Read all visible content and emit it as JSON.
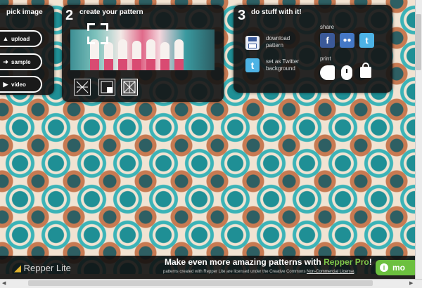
{
  "step1": {
    "title": "pick image",
    "buttons": [
      "upload",
      "sample",
      "video"
    ]
  },
  "step2": {
    "number": "2",
    "title": "create your pattern"
  },
  "step3": {
    "number": "3",
    "title": "do stuff with it!",
    "download": [
      "download",
      "pattern"
    ],
    "twitter": [
      "set as Twitter",
      "background"
    ],
    "share_label": "share",
    "print_label": "print"
  },
  "footer": {
    "promo_prefix": "Make even more amazing patterns with ",
    "promo_link": "Repper Pro",
    "promo_suffix": "!",
    "license_prefix": "patterns created with Repper Lite are licensed under the Creative Commons ",
    "license_link": "Non-Commercial License",
    "license_suffix": ".",
    "app_name": "Repper Lite",
    "more_button": "mo"
  },
  "colors": {
    "accent": "#6cc03f",
    "pattern_teal": "#3bb3b7",
    "panel": "#161616"
  },
  "icons": [
    "upload-arrow-icon",
    "sample-arrow-icon",
    "video-play-icon",
    "crop-icon",
    "floppy-disk-icon",
    "twitter-icon",
    "facebook-icon",
    "myspace-icon",
    "twitter-share-icon",
    "print-icon",
    "mouse-icon",
    "lock-icon"
  ]
}
